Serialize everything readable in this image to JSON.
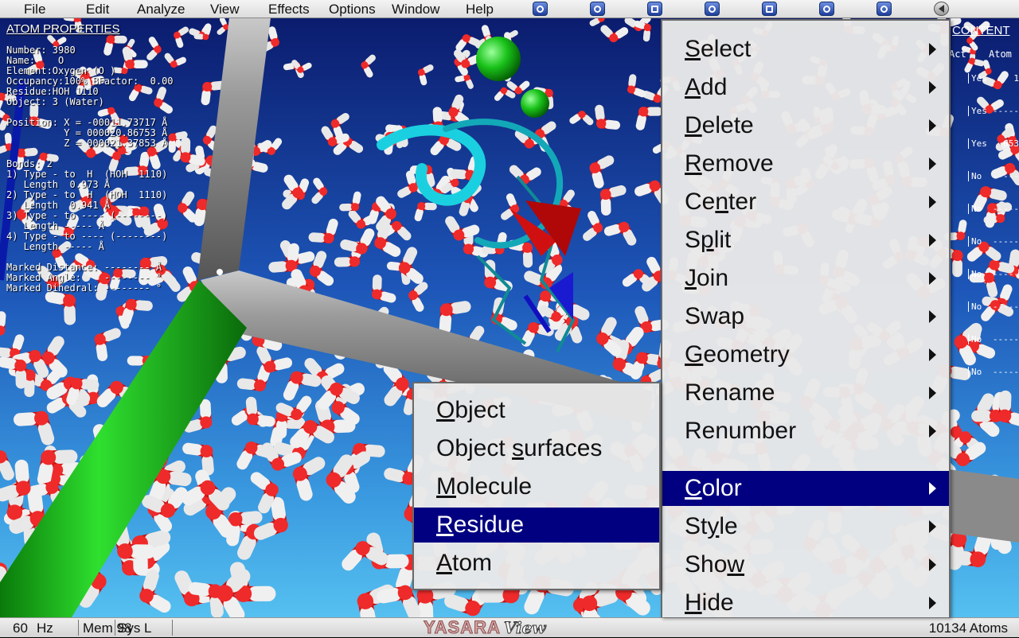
{
  "menubar": {
    "items": [
      "File",
      "Edit",
      "Analyze",
      "View",
      "Effects",
      "Options",
      "Window",
      "Help"
    ],
    "toolbar_icons": [
      "screen-icon",
      "globe-icon",
      "new-window-icon",
      "refresh-icon",
      "save-icon",
      "navigate-icon",
      "face-icon",
      "back-icon"
    ]
  },
  "atom_panel": {
    "title": "ATOM PROPERTIES",
    "lines": [
      "Number: 3980",
      "Name:    O",
      "Element:Oxygen (O )",
      "Occupancy:100% BFactor:  0.00",
      "Residue:HOH 1110",
      "Object: 3 (Water)",
      "",
      "Position: X = -00011.73717 Å",
      "          Y = 000020.86753 Å",
      "          Z = 000021.37853 Å",
      "",
      "Bonds: 2",
      "1) Type - to  H  (HOH  1110)",
      "   Length  0.973 Å",
      "2) Type - to  H  (HOH  1110)",
      "   Length  0.941 Å",
      "3) Type - to ---- (--------)",
      "   Length ----- Å",
      "4) Type - to ---- (--------)",
      "   Length ----- Å",
      "",
      "Marked Distance: -------- Å",
      "Marked Angle:    -------- °",
      "Marked Dihedral: -------- °"
    ]
  },
  "content_panel": {
    "title": "CONTENT",
    "headers": [
      "Act",
      "Atom"
    ],
    "rows": [
      {
        "act": "Yes",
        "atom": "1"
      },
      {
        "act": "Yes",
        "atom": "-----"
      },
      {
        "act": "Yes",
        "atom": "653"
      },
      {
        "act": "No",
        "atom": "-----"
      },
      {
        "act": "No",
        "atom": "-----"
      },
      {
        "act": "No",
        "atom": "-----"
      },
      {
        "act": "No",
        "atom": "-----"
      },
      {
        "act": "No",
        "atom": "-----"
      },
      {
        "act": "No",
        "atom": "-----"
      },
      {
        "act": "No",
        "atom": "-----"
      }
    ]
  },
  "main_menu": {
    "items": [
      {
        "pre": "",
        "u": "S",
        "post": "elect",
        "submenu": true
      },
      {
        "pre": "",
        "u": "A",
        "post": "dd",
        "submenu": true
      },
      {
        "pre": "",
        "u": "D",
        "post": "elete",
        "submenu": true
      },
      {
        "pre": "",
        "u": "R",
        "post": "emove",
        "submenu": true
      },
      {
        "pre": "Ce",
        "u": "n",
        "post": "ter",
        "submenu": true
      },
      {
        "pre": "S",
        "u": "p",
        "post": "lit",
        "submenu": true
      },
      {
        "pre": "",
        "u": "J",
        "post": "oin",
        "submenu": true
      },
      {
        "pre": "Swap",
        "u": "",
        "post": "",
        "submenu": true
      },
      {
        "pre": "",
        "u": "G",
        "post": "eometry",
        "submenu": true
      },
      {
        "pre": "Rename",
        "u": "",
        "post": "",
        "submenu": true
      },
      {
        "pre": "Renumber",
        "u": "",
        "post": "",
        "submenu": true
      },
      {
        "pre": "",
        "u": "C",
        "post": "olor",
        "submenu": true,
        "selected": true
      },
      {
        "pre": "St",
        "u": "y",
        "post": "le",
        "submenu": true
      },
      {
        "pre": "Sho",
        "u": "w",
        "post": "",
        "submenu": true
      },
      {
        "pre": "",
        "u": "H",
        "post": "ide",
        "submenu": true
      }
    ]
  },
  "color_submenu": {
    "items": [
      {
        "pre": "",
        "u": "O",
        "post": "bject"
      },
      {
        "pre": "Object ",
        "u": "s",
        "post": "urfaces"
      },
      {
        "pre": "",
        "u": "M",
        "post": "olecule"
      },
      {
        "pre": "",
        "u": "R",
        "post": "esidue",
        "selected": true
      },
      {
        "pre": "",
        "u": "A",
        "post": "tom"
      }
    ]
  },
  "statusbar": {
    "fps_value": "60",
    "fps_unit": "Hz",
    "mem": "Mem 98",
    "sys": "Sys L",
    "logo_main": "YASARA",
    "logo_sub": "View",
    "atoms": "10134 Atoms"
  },
  "colors": {
    "menu_highlight": "#000080",
    "oxygen": "#d81010",
    "hydrogen": "#e6e6e6",
    "cell_bond": "#8a8a8a",
    "cell_axis": "#1ec81e"
  }
}
